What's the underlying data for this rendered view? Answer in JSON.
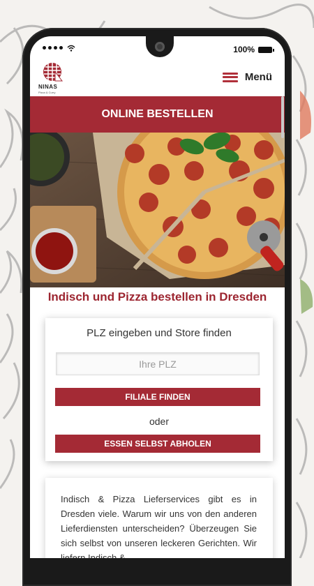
{
  "status_bar": {
    "battery": "100%"
  },
  "header": {
    "logo_name": "NINAS",
    "logo_tagline": "Pizza & Curry",
    "menu_label": "Menü"
  },
  "banner": {
    "title": "ONLINE BESTELLEN"
  },
  "hero": {
    "image_description": "pizza-photo"
  },
  "main": {
    "subtitle": "Indisch und Pizza bestellen in Dresden",
    "store_finder": {
      "title": "PLZ eingeben und Store finden",
      "plz_placeholder": "Ihre PLZ",
      "plz_value": "",
      "find_button": "FILIALE FINDEN",
      "or_text": "oder",
      "pickup_button": "ESSEN SELBST ABHOLEN"
    },
    "intro_text": "Indisch & Pizza Lieferservices gibt es in Dresden viele. Warum wir uns von den anderen Lieferdiensten unterscheiden? Überzeugen Sie sich selbst von unseren leckeren Gerichten. Wir liefern Indisch &"
  },
  "colors": {
    "brand": "#a42a35",
    "brand_text": "#9c2530"
  }
}
